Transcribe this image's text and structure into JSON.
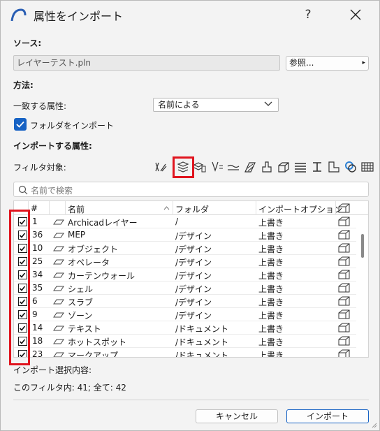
{
  "window": {
    "title": "属性をインポート",
    "help_label": "?"
  },
  "source": {
    "section_label": "ソース:",
    "file_value": "レイヤーテスト.pln",
    "browse_label": "参照...",
    "browse_arrow": "▸"
  },
  "method": {
    "section_label": "方法:",
    "match_label": "一致する属性:",
    "match_value": "名前による",
    "folder_import_label": "フォルダをインポート",
    "folder_import_checked": true
  },
  "attributes": {
    "section_label": "インポートする属性:",
    "filter_label": "フィルタ対象:",
    "filter_icons": [
      "pen-set-icon",
      "layer-icon",
      "layer-combination-icon",
      "pen-icon",
      "line-type-icon",
      "fill-icon",
      "building-material-icon",
      "composite-icon",
      "profile-icon",
      "surface-icon",
      "zone-category-icon",
      "mep-system-icon",
      "operation-profile-icon",
      "markup-style-icon"
    ],
    "selected_filter": "layer-icon"
  },
  "search": {
    "placeholder": "名前で検索"
  },
  "table": {
    "columns": {
      "check": "",
      "num": "#",
      "type": "",
      "name": "名前",
      "folder": "フォルダ",
      "option": "インポートオプション"
    },
    "rows": [
      {
        "num": "1",
        "name": "Archicadレイヤー",
        "folder": "/",
        "option": "上書き",
        "checked": true
      },
      {
        "num": "36",
        "name": "MEP",
        "folder": "/デザイン",
        "option": "上書き",
        "checked": true
      },
      {
        "num": "10",
        "name": "オブジェクト",
        "folder": "/デザイン",
        "option": "上書き",
        "checked": true
      },
      {
        "num": "25",
        "name": "オペレータ",
        "folder": "/デザイン",
        "option": "上書き",
        "checked": true
      },
      {
        "num": "34",
        "name": "カーテンウォール",
        "folder": "/デザイン",
        "option": "上書き",
        "checked": true
      },
      {
        "num": "35",
        "name": "シェル",
        "folder": "/デザイン",
        "option": "上書き",
        "checked": true
      },
      {
        "num": "6",
        "name": "スラブ",
        "folder": "/デザイン",
        "option": "上書き",
        "checked": true
      },
      {
        "num": "9",
        "name": "ゾーン",
        "folder": "/デザイン",
        "option": "上書き",
        "checked": true
      },
      {
        "num": "14",
        "name": "テキスト",
        "folder": "/ドキュメント",
        "option": "上書き",
        "checked": true
      },
      {
        "num": "18",
        "name": "ホットスポット",
        "folder": "/ドキュメント",
        "option": "上書き",
        "checked": true
      },
      {
        "num": "23",
        "name": "マークアップ",
        "folder": "/ドキュメント",
        "option": "上書き",
        "checked": true
      }
    ]
  },
  "summary": {
    "selection_label": "インポート選択内容:",
    "counts": "このフィルタ内: 41; 全て: 42"
  },
  "buttons": {
    "cancel": "キャンセル",
    "import": "インポート"
  },
  "colors": {
    "accent": "#1662c4",
    "highlight_annotation": "#e0141e"
  }
}
